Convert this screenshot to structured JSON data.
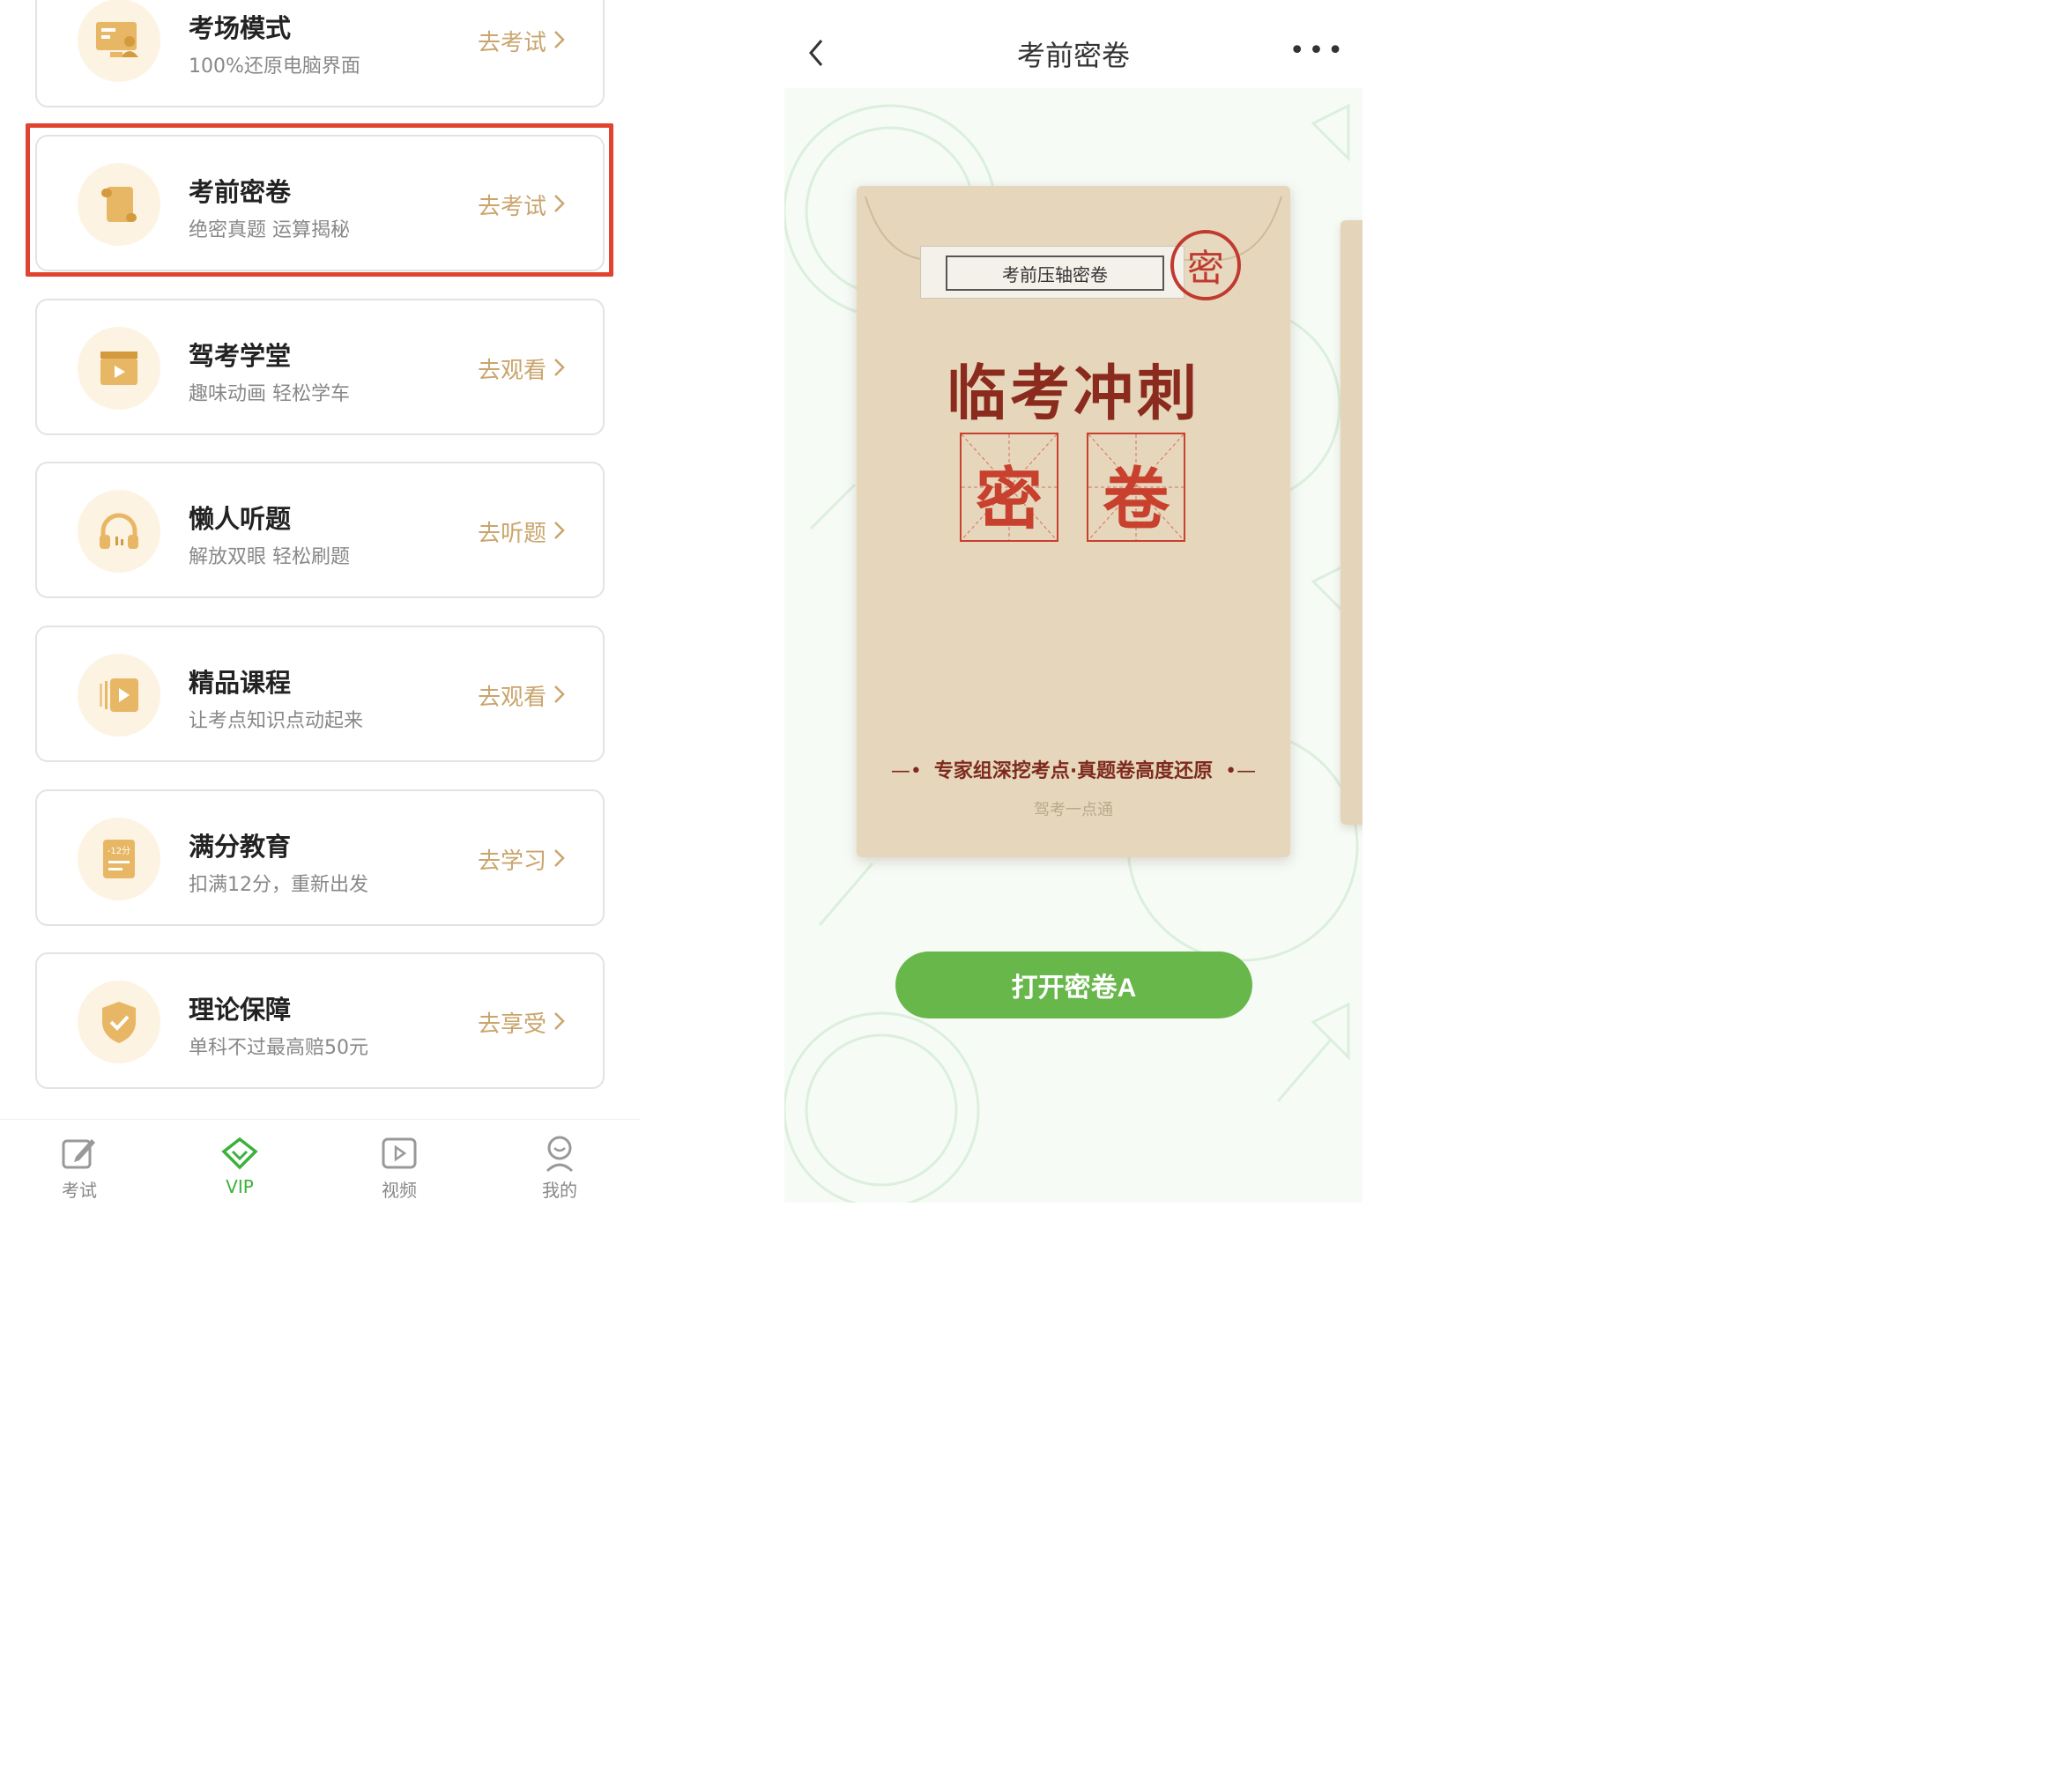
{
  "left": {
    "cards": [
      {
        "title": "考场模式",
        "subtitle": "100%还原电脑界面",
        "action": "去考试",
        "icon": "computer-exam-icon"
      },
      {
        "title": "考前密卷",
        "subtitle": "绝密真题 运算揭秘",
        "action": "去考试",
        "icon": "scroll-icon"
      },
      {
        "title": "驾考学堂",
        "subtitle": "趣味动画 轻松学车",
        "action": "去观看",
        "icon": "clapperboard-icon"
      },
      {
        "title": "懒人听题",
        "subtitle": "解放双眼 轻松刷题",
        "action": "去听题",
        "icon": "headphones-icon"
      },
      {
        "title": "精品课程",
        "subtitle": "让考点知识点动起来",
        "action": "去观看",
        "icon": "video-play-icon"
      },
      {
        "title": "满分教育",
        "subtitle": "扣满12分，重新出发",
        "action": "去学习",
        "icon": "penalty-doc-icon",
        "icon_text": "-12分"
      },
      {
        "title": "理论保障",
        "subtitle": "单科不过最高赔50元",
        "action": "去享受",
        "icon": "shield-check-icon"
      }
    ],
    "tabbar": [
      {
        "label": "考试",
        "icon": "edit-icon",
        "active": false
      },
      {
        "label": "VIP",
        "icon": "diamond-icon",
        "active": true
      },
      {
        "label": "视频",
        "icon": "video-icon",
        "active": false
      },
      {
        "label": "我的",
        "icon": "user-icon",
        "active": false
      }
    ]
  },
  "right": {
    "nav_title": "考前密卷",
    "more": "•••",
    "envelope": {
      "label": "考前压轴密卷",
      "seal": "密",
      "title": "临考冲刺",
      "char1": "密",
      "char2": "卷",
      "tagline": "专家组深挖考点·真题卷高度还原",
      "brand": "驾考一点通"
    },
    "button": "打开密卷A"
  },
  "colors": {
    "accent_gold": "#c9a56c",
    "highlight_red": "#e0432f",
    "vip_green": "#3cb13c",
    "button_green": "#68b74a",
    "seal_red": "#c03a30"
  }
}
